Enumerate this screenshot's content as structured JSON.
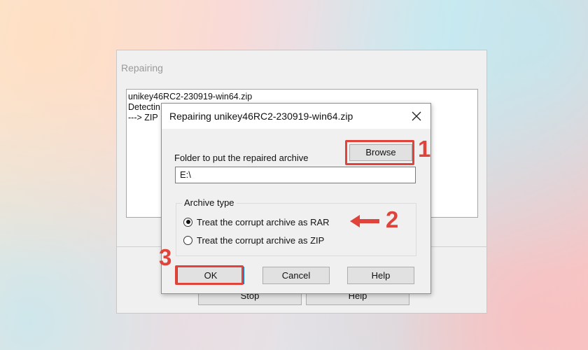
{
  "outer_window": {
    "title": "Repairing",
    "log_lines": [
      "unikey46RC2-230919-win64.zip",
      "Detectin",
      "---> ZIP"
    ],
    "stop_label": "Stop",
    "help_label": "Help"
  },
  "dialog": {
    "title": "Repairing unikey46RC2-230919-win64.zip",
    "folder_label": "Folder to put the repaired archive",
    "browse_label": "Browse",
    "folder_value": "E:\\",
    "archive_type_label": "Archive type",
    "options": [
      {
        "label": "Treat the corrupt archive as RAR",
        "checked": true
      },
      {
        "label": "Treat the corrupt archive as ZIP",
        "checked": false
      }
    ],
    "ok_label": "OK",
    "cancel_label": "Cancel",
    "help_label": "Help"
  },
  "annotations": {
    "step1": "1",
    "step2": "2",
    "step3": "3",
    "color": "#e0433a"
  }
}
